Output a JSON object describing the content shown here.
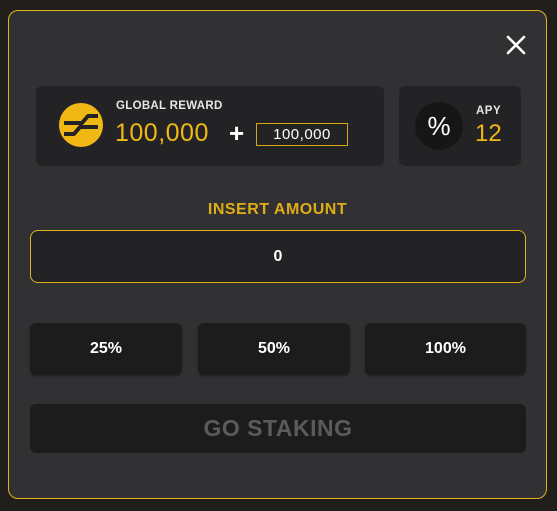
{
  "modal": {
    "close_icon": "close-icon",
    "accent_color": "#e3b21b"
  },
  "reward": {
    "label": "GLOBAL REWARD",
    "value": "100,000",
    "plus": "+",
    "extra_value": "100,000",
    "coin_icon": "coin-icon"
  },
  "apy": {
    "symbol": "%",
    "label": "APY",
    "value": "12"
  },
  "amount": {
    "label": "INSERT AMOUNT",
    "value": "0"
  },
  "percent_buttons": [
    "25%",
    "50%",
    "100%"
  ],
  "stake_button": {
    "label": "GO STAKING",
    "state": "disabled"
  }
}
